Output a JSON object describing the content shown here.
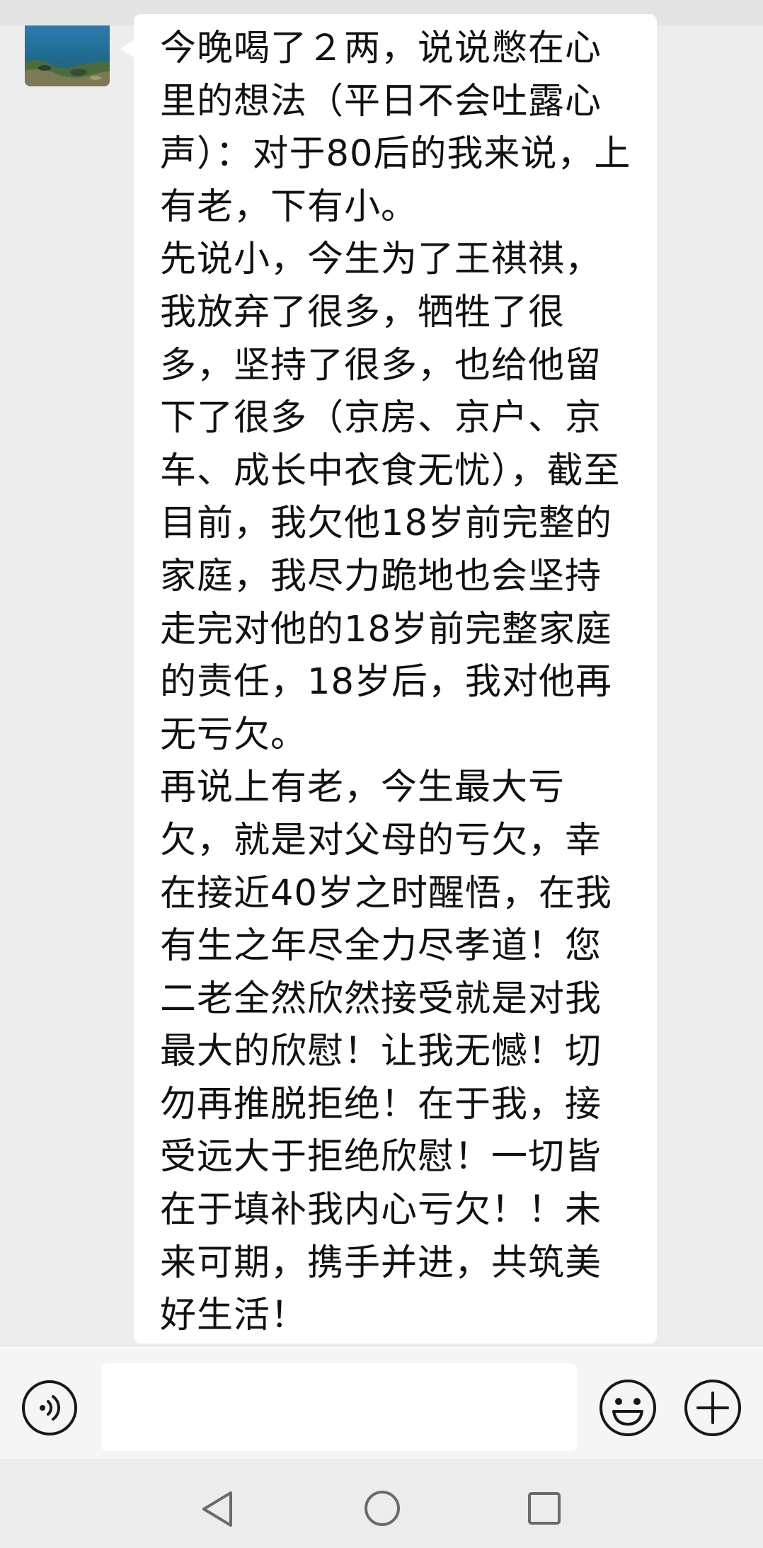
{
  "conversation": {
    "message": {
      "text": "今晚喝了２两，说说憋在心里的想法（平日不会吐露心声）：对于80后的我来说，上有老，下有小。\n先说小，今生为了王祺祺，我放弃了很多，牺牲了很多，坚持了很多，也给他留下了很多（京房、京户、京车、成长中衣食无忧），截至目前，我欠他18岁前完整的家庭，我尽力跪地也会坚持走完对他的18岁前完整家庭的责任，18岁后，我对他再无亏欠。\n再说上有老，今生最大亏欠，就是对父母的亏欠，幸在接近40岁之时醒悟，在我有生之年尽全力尽孝道！您二老全然欣然接受就是对我最大的欣慰！让我无憾！切勿再推脱拒绝！在于我，接受远大于拒绝欣慰！一切皆在于填补我内心亏欠！！未来可期，携手并进，共筑美好生活！"
    }
  },
  "input_bar": {
    "voice_icon": "voice-icon",
    "input_value": "",
    "emoji_icon": "emoji-icon",
    "plus_icon": "plus-icon"
  },
  "navigation": {
    "back_icon": "back-triangle-icon",
    "home_icon": "home-circle-icon",
    "recents_icon": "recents-square-icon"
  },
  "colors": {
    "chat_background": "#ededed",
    "bubble_background": "#ffffff",
    "text": "#111111",
    "input_bar_background": "#f5f5f5",
    "icon_stroke": "#181818"
  }
}
